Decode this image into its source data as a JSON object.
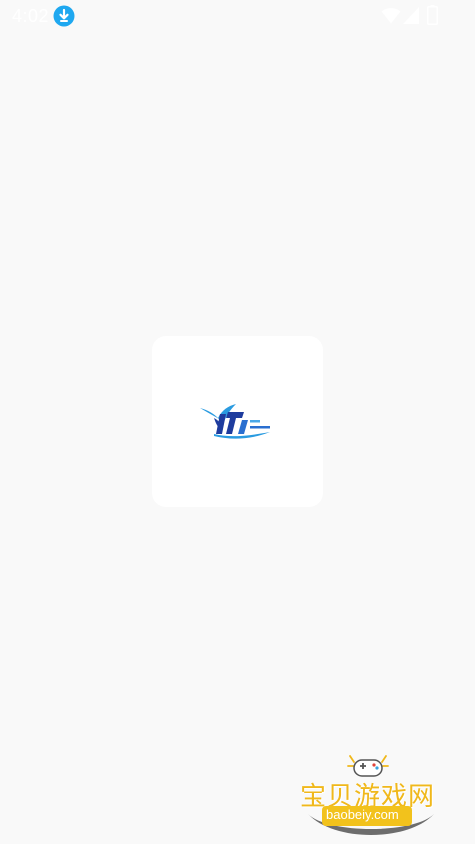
{
  "status_bar": {
    "time": "4:02",
    "download_icon": "download-arrow-circle",
    "wifi_icon": "wifi",
    "signal_icon": "cell-signal",
    "battery_icon": "battery"
  },
  "splash": {
    "logo_icon": "app-logo-bird"
  },
  "watermark": {
    "title": "宝贝游戏网",
    "url": "baobeiy.com",
    "icon": "game-controller"
  },
  "colors": {
    "background": "#f9f9f9",
    "card": "#ffffff",
    "download_badge": "#1fa8f0",
    "watermark_text": "#f0b81b",
    "logo_blue": "#1e3c9e"
  }
}
